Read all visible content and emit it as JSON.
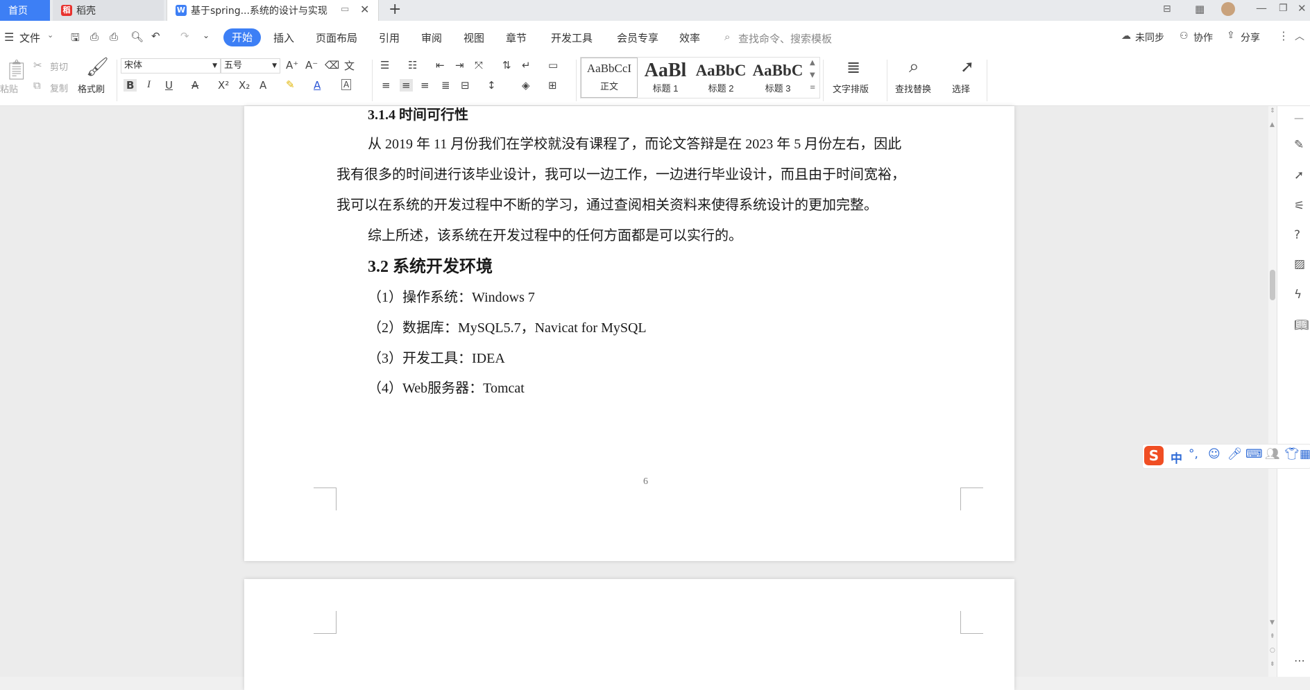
{
  "tabs": {
    "home": "首页",
    "docer": "稻壳",
    "document": "基于spring...系统的设计与实现",
    "add": "+"
  },
  "menu": {
    "file": "文件",
    "items": [
      "开始",
      "插入",
      "页面布局",
      "引用",
      "审阅",
      "视图",
      "章节",
      "开发工具",
      "会员专享",
      "效率"
    ],
    "search_placeholder": "查找命令、搜索模板",
    "unsynced": "未同步",
    "collaborate": "协作",
    "share": "分享"
  },
  "ribbon": {
    "paste": "粘贴",
    "cut": "剪切",
    "copy": "复制",
    "format_painter": "格式刷",
    "font_name": "宋体",
    "font_size": "五号",
    "styles": [
      {
        "sample": "AaBbCcI",
        "label": "正文"
      },
      {
        "sample": "AaBl",
        "label": "标题 1"
      },
      {
        "sample": "AaBbC",
        "label": "标题 2"
      },
      {
        "sample": "AaBbC",
        "label": "标题 3"
      }
    ],
    "text_layout": "文字排版",
    "find_replace": "查找替换",
    "select": "选择"
  },
  "document": {
    "section_heading": "3.1.4   时间可行性",
    "para1_line1": "从 2019 年 11 月份我们在学校就没有课程了，而论文答辩是在 2023 年 5 月份左右，因此",
    "para1_line2": "我有很多的时间进行该毕业设计，我可以一边工作，一边进行毕业设计，而且由于时间宽裕，",
    "para1_line3": "我可以在系统的开发过程中不断的学习，通过查阅相关资料来使得系统设计的更加完整。",
    "para2": "综上所述，该系统在开发过程中的任何方面都是可以实行的。",
    "heading_32": "3.2    系统开发环境",
    "list": [
      "（1）操作系统：Windows 7",
      "（2）数据库：MySQL5.7，Navicat for MySQL",
      "（3）开发工具：IDEA",
      "（4）Web服务器：Tomcat"
    ],
    "page_number": "6"
  },
  "ime": {
    "lang": "中"
  },
  "colors": {
    "accent": "#3d7ff5",
    "ime_brand": "#f04e23"
  }
}
